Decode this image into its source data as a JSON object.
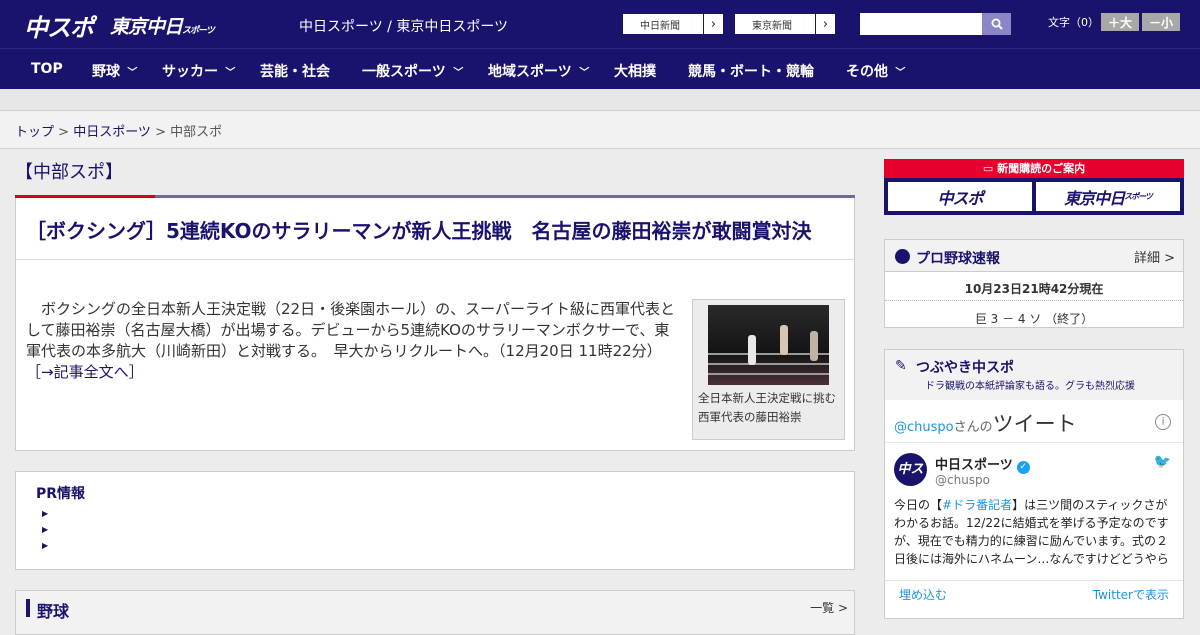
{
  "header": {
    "logo_primary": "中スポ",
    "logo_secondary": "東京中日",
    "logo_secondary_small": "スポーツ",
    "site_name": "中日スポーツ / 東京中日スポーツ",
    "link_chunichi": "中日新聞",
    "link_tokyo": "東京新聞",
    "search_placeholder": "",
    "font_size_label": "文字（0）",
    "font_increase": "＋大",
    "font_decrease": "－小"
  },
  "nav": {
    "items": [
      {
        "label": "TOP",
        "dropdown": false
      },
      {
        "label": "野球",
        "dropdown": true
      },
      {
        "label": "サッカー",
        "dropdown": true
      },
      {
        "label": "芸能・社会",
        "dropdown": false
      },
      {
        "label": "一般スポーツ",
        "dropdown": true
      },
      {
        "label": "地域スポーツ",
        "dropdown": true
      },
      {
        "label": "大相撲",
        "dropdown": false
      },
      {
        "label": "競馬・ボート・競輪",
        "dropdown": false
      },
      {
        "label": "その他",
        "dropdown": true
      }
    ]
  },
  "breadcrumb": {
    "items": [
      "トップ",
      "中日スポーツ",
      "中部スポ"
    ],
    "separator": " > "
  },
  "section": {
    "title": "【中部スポ】"
  },
  "article": {
    "title": "［ボクシング］5連続KOのサラリーマンが新人王挑戦　名古屋の藤田裕崇が敢闘賞対決",
    "lead": "ボクシングの全日本新人王決定戦（22日・後楽園ホール）の、スーパーライト級に西軍代表として藤田裕崇（名古屋大橋）が出場する。デビューから5連続KOのサラリーマンボクサーで、東軍代表の本多航大（川崎新田）と対戦する。　早大からリクルートへ。（12月20日 11時22分）",
    "read_more": "［→記事全文へ］",
    "photo_caption": "全日本新人王決定戦に挑む西軍代表の藤田裕崇"
  },
  "pr": {
    "title": "PR情報",
    "items": [
      "",
      "",
      ""
    ]
  },
  "yakyu": {
    "title": "野球",
    "more": "一覧 >"
  },
  "sidebar": {
    "ad": {
      "banner": "新聞購読のご案内",
      "left": "中スポ",
      "right": "東京中日",
      "right_small": "スポーツ"
    },
    "baseball": {
      "title": "プロ野球速報",
      "more": "詳細 >",
      "time": "10月23日21時42分現在",
      "score": "巨 3 － 4 ソ （終了）"
    },
    "twitter": {
      "title": "つぶやき中スポ",
      "subtitle": "ドラ観戦の本紙評論家も語る。グラも熱烈応援",
      "handle_link": "@chuspo",
      "handle_suffix": "さんの",
      "tweets_label": "ツイート",
      "account_name": "中日スポーツ",
      "account_handle": "@chuspo",
      "tweet_prefix": "今日の【",
      "tweet_tag": "#ドラ番記者",
      "tweet_body": "】は三ツ間のスティックさがわかるお話。12/22に結婚式を挙げる予定なのですが、現在でも精力的に練習に励んでいます。式の２日後には海外にハネムーン…なんですけどどうやら",
      "embed": "埋め込む",
      "view_on": "Twitterで表示"
    }
  },
  "colors": {
    "brand": "#1a136e",
    "accent": "#d4001a",
    "twitter": "#1b95e0"
  }
}
